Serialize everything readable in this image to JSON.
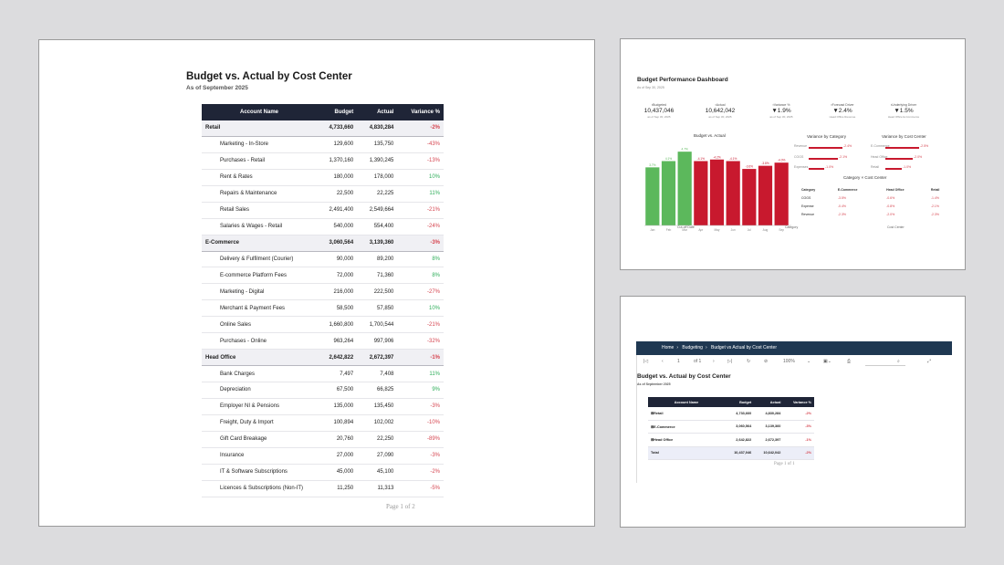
{
  "report": {
    "title": "Budget vs. Actual by Cost Center",
    "subtitle": "As of September 2025",
    "headers": [
      "Account Name",
      "Budget",
      "Actual",
      "Variance %"
    ],
    "rows": [
      {
        "type": "group",
        "name": "Retail",
        "budget": "4,733,660",
        "actual": "4,830,284",
        "var": "-2%",
        "sign": "neg"
      },
      {
        "type": "sub",
        "name": "Marketing - In-Store",
        "budget": "129,600",
        "actual": "135,750",
        "var": "-43%",
        "sign": "neg"
      },
      {
        "type": "sub",
        "name": "Purchases - Retail",
        "budget": "1,370,160",
        "actual": "1,390,245",
        "var": "-13%",
        "sign": "neg"
      },
      {
        "type": "sub",
        "name": "Rent & Rates",
        "budget": "180,000",
        "actual": "178,000",
        "var": "10%",
        "sign": "pos"
      },
      {
        "type": "sub",
        "name": "Repairs & Maintenance",
        "budget": "22,500",
        "actual": "22,225",
        "var": "11%",
        "sign": "pos"
      },
      {
        "type": "sub",
        "name": "Retail Sales",
        "budget": "2,491,400",
        "actual": "2,549,664",
        "var": "-21%",
        "sign": "neg"
      },
      {
        "type": "sub",
        "name": "Salaries & Wages - Retail",
        "budget": "540,000",
        "actual": "554,400",
        "var": "-24%",
        "sign": "neg"
      },
      {
        "type": "group",
        "name": "E-Commerce",
        "budget": "3,060,564",
        "actual": "3,139,360",
        "var": "-3%",
        "sign": "neg"
      },
      {
        "type": "sub",
        "name": "Delivery & Fulfilment (Courier)",
        "budget": "90,000",
        "actual": "89,200",
        "var": "8%",
        "sign": "pos"
      },
      {
        "type": "sub",
        "name": "E-commerce Platform Fees",
        "budget": "72,000",
        "actual": "71,360",
        "var": "8%",
        "sign": "pos"
      },
      {
        "type": "sub",
        "name": "Marketing - Digital",
        "budget": "216,000",
        "actual": "222,500",
        "var": "-27%",
        "sign": "neg"
      },
      {
        "type": "sub",
        "name": "Merchant & Payment Fees",
        "budget": "58,500",
        "actual": "57,850",
        "var": "10%",
        "sign": "pos"
      },
      {
        "type": "sub",
        "name": "Online Sales",
        "budget": "1,660,800",
        "actual": "1,700,544",
        "var": "-21%",
        "sign": "neg"
      },
      {
        "type": "sub",
        "name": "Purchases - Online",
        "budget": "963,264",
        "actual": "997,906",
        "var": "-32%",
        "sign": "neg"
      },
      {
        "type": "group",
        "name": "Head Office",
        "budget": "2,642,822",
        "actual": "2,672,397",
        "var": "-1%",
        "sign": "neg"
      },
      {
        "type": "sub",
        "name": "Bank Charges",
        "budget": "7,497",
        "actual": "7,408",
        "var": "11%",
        "sign": "pos"
      },
      {
        "type": "sub",
        "name": "Depreciation",
        "budget": "67,500",
        "actual": "66,825",
        "var": "9%",
        "sign": "pos"
      },
      {
        "type": "sub",
        "name": "Employer NI & Pensions",
        "budget": "135,000",
        "actual": "135,450",
        "var": "-3%",
        "sign": "neg"
      },
      {
        "type": "sub",
        "name": "Freight, Duty & Import",
        "budget": "100,894",
        "actual": "102,002",
        "var": "-10%",
        "sign": "neg"
      },
      {
        "type": "sub",
        "name": "Gift Card Breakage",
        "budget": "20,760",
        "actual": "22,250",
        "var": "-89%",
        "sign": "neg"
      },
      {
        "type": "sub",
        "name": "Insurance",
        "budget": "27,000",
        "actual": "27,090",
        "var": "-3%",
        "sign": "neg"
      },
      {
        "type": "sub",
        "name": "IT & Software Subscriptions",
        "budget": "45,000",
        "actual": "45,100",
        "var": "-2%",
        "sign": "neg"
      },
      {
        "type": "sub",
        "name": "Licences & Subscriptions (Non-IT)",
        "budget": "11,250",
        "actual": "11,313",
        "var": "-5%",
        "sign": "neg"
      }
    ],
    "pager": "Page 1 of 2"
  },
  "dashboard": {
    "title": "Budget Performance Dashboard",
    "subtitle": "As of Sep 30, 2025",
    "kpis": [
      {
        "label": "Budgeted",
        "value": "10,437,046",
        "note": "as of Sep 30, 2025",
        "icon": "wallet-icon"
      },
      {
        "label": "Actual",
        "value": "10,642,042",
        "note": "as of Sep 30, 2025",
        "icon": "receipt-icon"
      },
      {
        "label": "Variance %",
        "value": "▼1.9%",
        "note": "as of Sep 30, 2025",
        "icon": "percent-icon"
      },
      {
        "label": "Forecast Driver",
        "value": "▼2.4%",
        "note": "Head Office Revenue",
        "icon": "trend-icon"
      },
      {
        "label": "Underlying Driver",
        "value": "▼1.5%",
        "note": "Head Office E-Commerce",
        "icon": "chart-icon"
      }
    ],
    "chart_title": "Budget vs. Actual",
    "x_caption": "Cut-off Date",
    "variance_category_title": "Variance by Category",
    "variance_category": [
      {
        "label": "Revenue",
        "value": "-2.4%",
        "pct": 0.62
      },
      {
        "label": "COGS",
        "value": "-2.1%",
        "pct": 0.54
      },
      {
        "label": "Expenses",
        "value": "-1.0%",
        "pct": 0.28
      }
    ],
    "variance_cc_title": "Variance by Cost Center",
    "variance_cc": [
      {
        "label": "E-Commerce",
        "value": "-2.5%",
        "pct": 0.62
      },
      {
        "label": "Head Office",
        "value": "-2.0%",
        "pct": 0.5
      },
      {
        "label": "Retail",
        "value": "-1.0%",
        "pct": 0.3
      }
    ],
    "matrix_title": "Category × Cost Center",
    "matrix_headers": [
      "Category",
      "E-Commerce",
      "Head Office",
      "Retail"
    ],
    "matrix_rows": [
      [
        "COGS",
        "-3.5%",
        "-0.6%",
        "-1.4%"
      ],
      [
        "Expense",
        "-0.4%",
        "-0.8%",
        "-2.1%"
      ],
      [
        "Revenue",
        "-2.3%",
        "-2.0%",
        "-2.3%"
      ]
    ],
    "footer_left": "Category",
    "footer_right": "Cost Center"
  },
  "chart_data": {
    "type": "bar",
    "title": "Budget vs. Actual",
    "categories": [
      "Jan",
      "Feb",
      "Mar",
      "Apr",
      "May",
      "Jun",
      "Jul",
      "Aug",
      "Sep"
    ],
    "values": [
      3.7,
      4.1,
      4.7,
      4.1,
      4.2,
      4.1,
      3.6,
      3.8,
      4.0
    ],
    "data_labels": [
      "3.7%",
      "4.1%",
      "4.7%",
      "-4.1%",
      "-4.2%",
      "-4.1%",
      "-3.6%",
      "-3.8%",
      "-4.0%"
    ],
    "colors": [
      "#5cb85c",
      "#5cb85c",
      "#5cb85c",
      "#c8192e",
      "#c8192e",
      "#c8192e",
      "#c8192e",
      "#c8192e",
      "#c8192e"
    ],
    "ylim": [
      0,
      5
    ],
    "grid": false
  },
  "viewer": {
    "breadcrumbs": [
      "Home",
      "Budgeting",
      "Budget vs Actual by Cost Center"
    ],
    "page_input": "1",
    "page_of": "of 1",
    "zoom": "100%",
    "title": "Budget vs. Actual by Cost Center",
    "subtitle": "As of September 2025",
    "headers": [
      "Account Name",
      "Budget",
      "Actual",
      "Variance %"
    ],
    "rows": [
      {
        "name": "⊞Retail",
        "budget": "4,733,660",
        "actual": "4,830,284",
        "var": "-2%"
      },
      {
        "name": "⊞E-Commerce",
        "budget": "3,060,564",
        "actual": "3,139,360",
        "var": "-3%"
      },
      {
        "name": "⊞Head Office",
        "budget": "2,642,822",
        "actual": "2,672,397",
        "var": "-1%"
      },
      {
        "name": "Total",
        "budget": "10,437,046",
        "actual": "10,642,042",
        "var": "-2%"
      }
    ],
    "pager": "Page 1 of 1"
  }
}
